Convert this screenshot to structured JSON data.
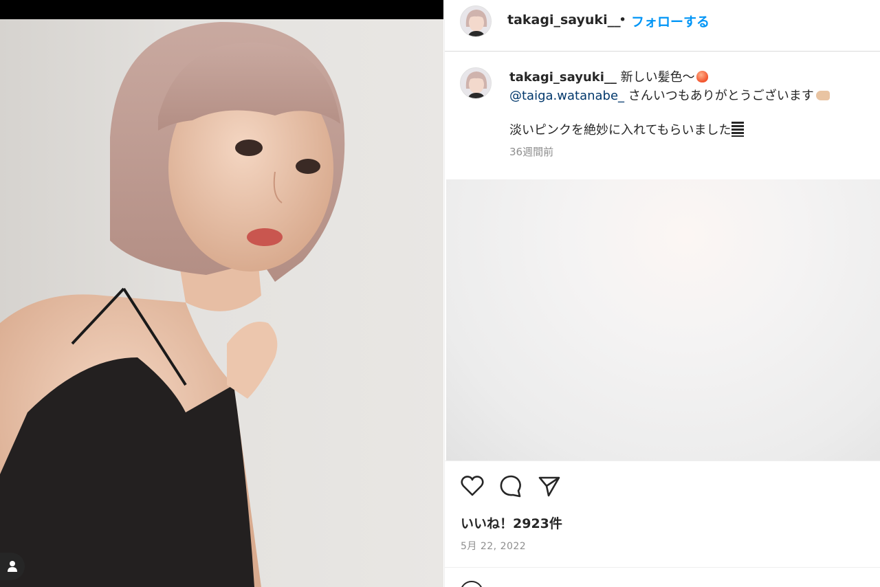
{
  "post": {
    "username": "takagi_sayuki__",
    "separator": "•",
    "follow_label": "フォローする",
    "caption_text": " 新しい髪色〜",
    "mention": "@taiga.watanabe_",
    "caption_line2": " さんいつもありがとうございます",
    "caption_line3": "淡いピンクを絶妙に入れてもらいました",
    "time_ago": "36週間前",
    "likes": "いいね！2923件",
    "date": "5月 22, 2022"
  },
  "icons": {
    "like": "heart-icon",
    "comment": "comment-icon",
    "share": "paper-plane-icon",
    "user_tag": "user-icon"
  },
  "colors": {
    "follow": "#0095f6",
    "mention": "#00376b",
    "text": "#262626",
    "muted": "#8e8e8e"
  }
}
